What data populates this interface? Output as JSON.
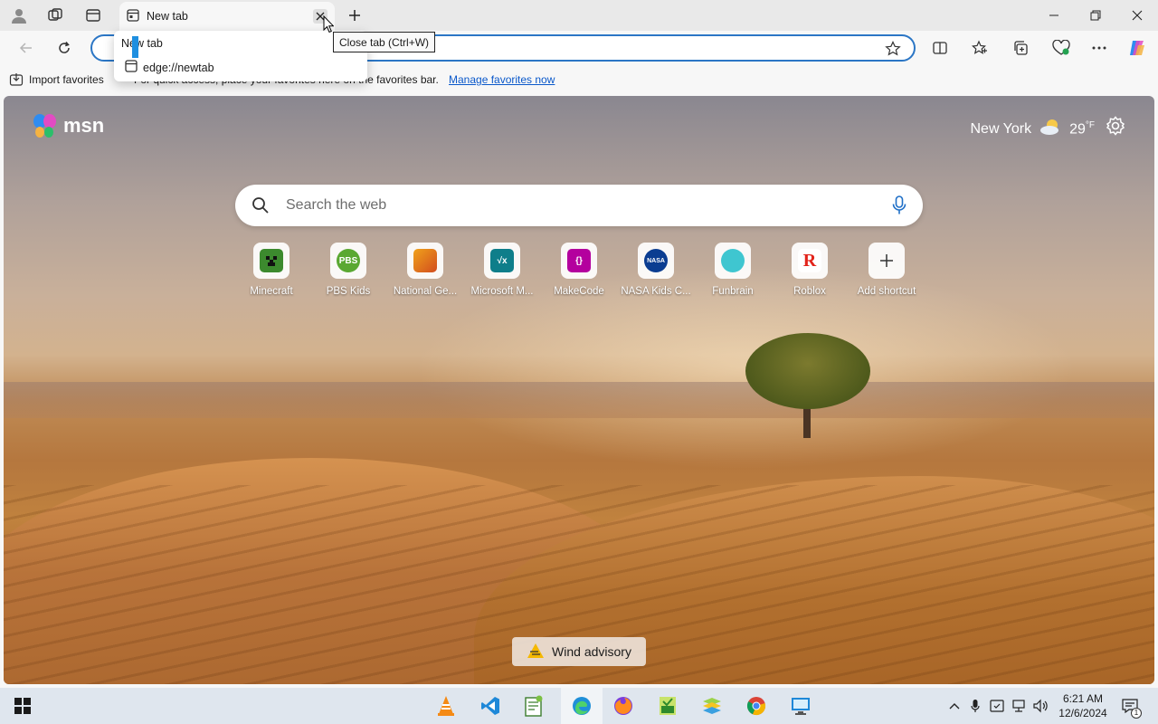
{
  "tab": {
    "title": "New tab",
    "close_tooltip": "Close tab (Ctrl+W)"
  },
  "tab_popup": {
    "title": "New tab",
    "url": "edge://newtab"
  },
  "favorites_bar": {
    "import_label": "Import favorites",
    "hint": "For quick access, place your favorites here on the favorites bar.",
    "manage_link": "Manage favorites now"
  },
  "msn": {
    "logo_text": "msn",
    "weather": {
      "city": "New York",
      "temp": "29",
      "unit": "°F"
    },
    "search_placeholder": "Search the web",
    "shortcuts": [
      {
        "label": "Minecraft",
        "icon": "minecraft-icon",
        "color": "#3c8a2e"
      },
      {
        "label": "PBS Kids",
        "icon": "pbs-kids-icon",
        "color": "#5aa832"
      },
      {
        "label": "National Ge...",
        "icon": "national-geographic-icon",
        "color": "#f0a21b"
      },
      {
        "label": "Microsoft M...",
        "icon": "microsoft-math-icon",
        "color": "#0e7e8a"
      },
      {
        "label": "MakeCode",
        "icon": "makecode-icon",
        "color": "#b4009e"
      },
      {
        "label": "NASA Kids C...",
        "icon": "nasa-icon",
        "color": "#0b3d91"
      },
      {
        "label": "Funbrain",
        "icon": "funbrain-icon",
        "color": "#3fc6d0"
      },
      {
        "label": "Roblox",
        "icon": "roblox-icon",
        "color": "#e2231a"
      },
      {
        "label": "Add shortcut",
        "icon": "plus-icon",
        "color": "#ffffff"
      }
    ],
    "wind_label": "Wind advisory"
  },
  "taskbar": {
    "time": "6:21 AM",
    "date": "12/6/2024",
    "notification_count": "1"
  },
  "colors": {
    "accent": "#2b76c5",
    "link": "#0a58ca",
    "taskbar": "#dfe6ee"
  }
}
